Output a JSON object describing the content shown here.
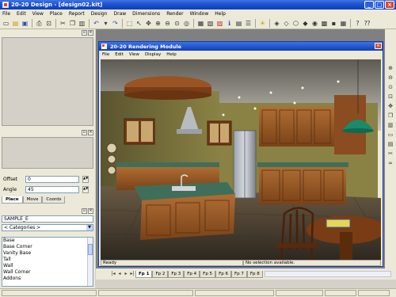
{
  "app": {
    "title": "20-20 Design - [design02.kit]",
    "menus": [
      "File",
      "Edit",
      "View",
      "Place",
      "Report",
      "Design",
      "Draw",
      "Dimensions",
      "Render",
      "Window",
      "Help"
    ]
  },
  "toolbar": {
    "icons": [
      "new-icon",
      "open-icon",
      "save-icon",
      "print-icon",
      "cut-icon",
      "copy-icon",
      "paste-icon",
      "undo-icon",
      "select-icon",
      "zoom-in-icon",
      "zoom-out-icon",
      "zoom-window-icon",
      "pan-icon",
      "info-icon",
      "catalog-icon",
      "lightbulb-icon",
      "3d-view-icon"
    ]
  },
  "left_panel": {
    "offset_label": "Offset",
    "offset_value": "0",
    "angle_label": "Angle",
    "angle_value": "45",
    "tabs": [
      "Place",
      "Move",
      "Coords"
    ],
    "sample_value": "SAMPLE_E",
    "categories_value": "< Categories >",
    "category_items": [
      "Base",
      "Base Corner",
      "Vanity Base",
      "Tall",
      "Wall",
      "Wall Corner",
      "Addons"
    ]
  },
  "render_window": {
    "title": "20-20 Rendering Module",
    "menus": [
      "File",
      "Edit",
      "View",
      "Display",
      "Help"
    ],
    "status_left": "Ready",
    "status_right": "No selection available."
  },
  "page_tabs": [
    "Fp 1",
    "Fp 2",
    "Fp 3",
    "Fp 4",
    "Fp 5",
    "Fp 6",
    "Fp 7",
    "Fp 8"
  ],
  "colors": {
    "titlebar": "#0d3fb8",
    "wood": "#9a5a2a",
    "countertop": "#3f6f5a",
    "wall": "#8c8446",
    "pendant": "#1a8a6a"
  }
}
